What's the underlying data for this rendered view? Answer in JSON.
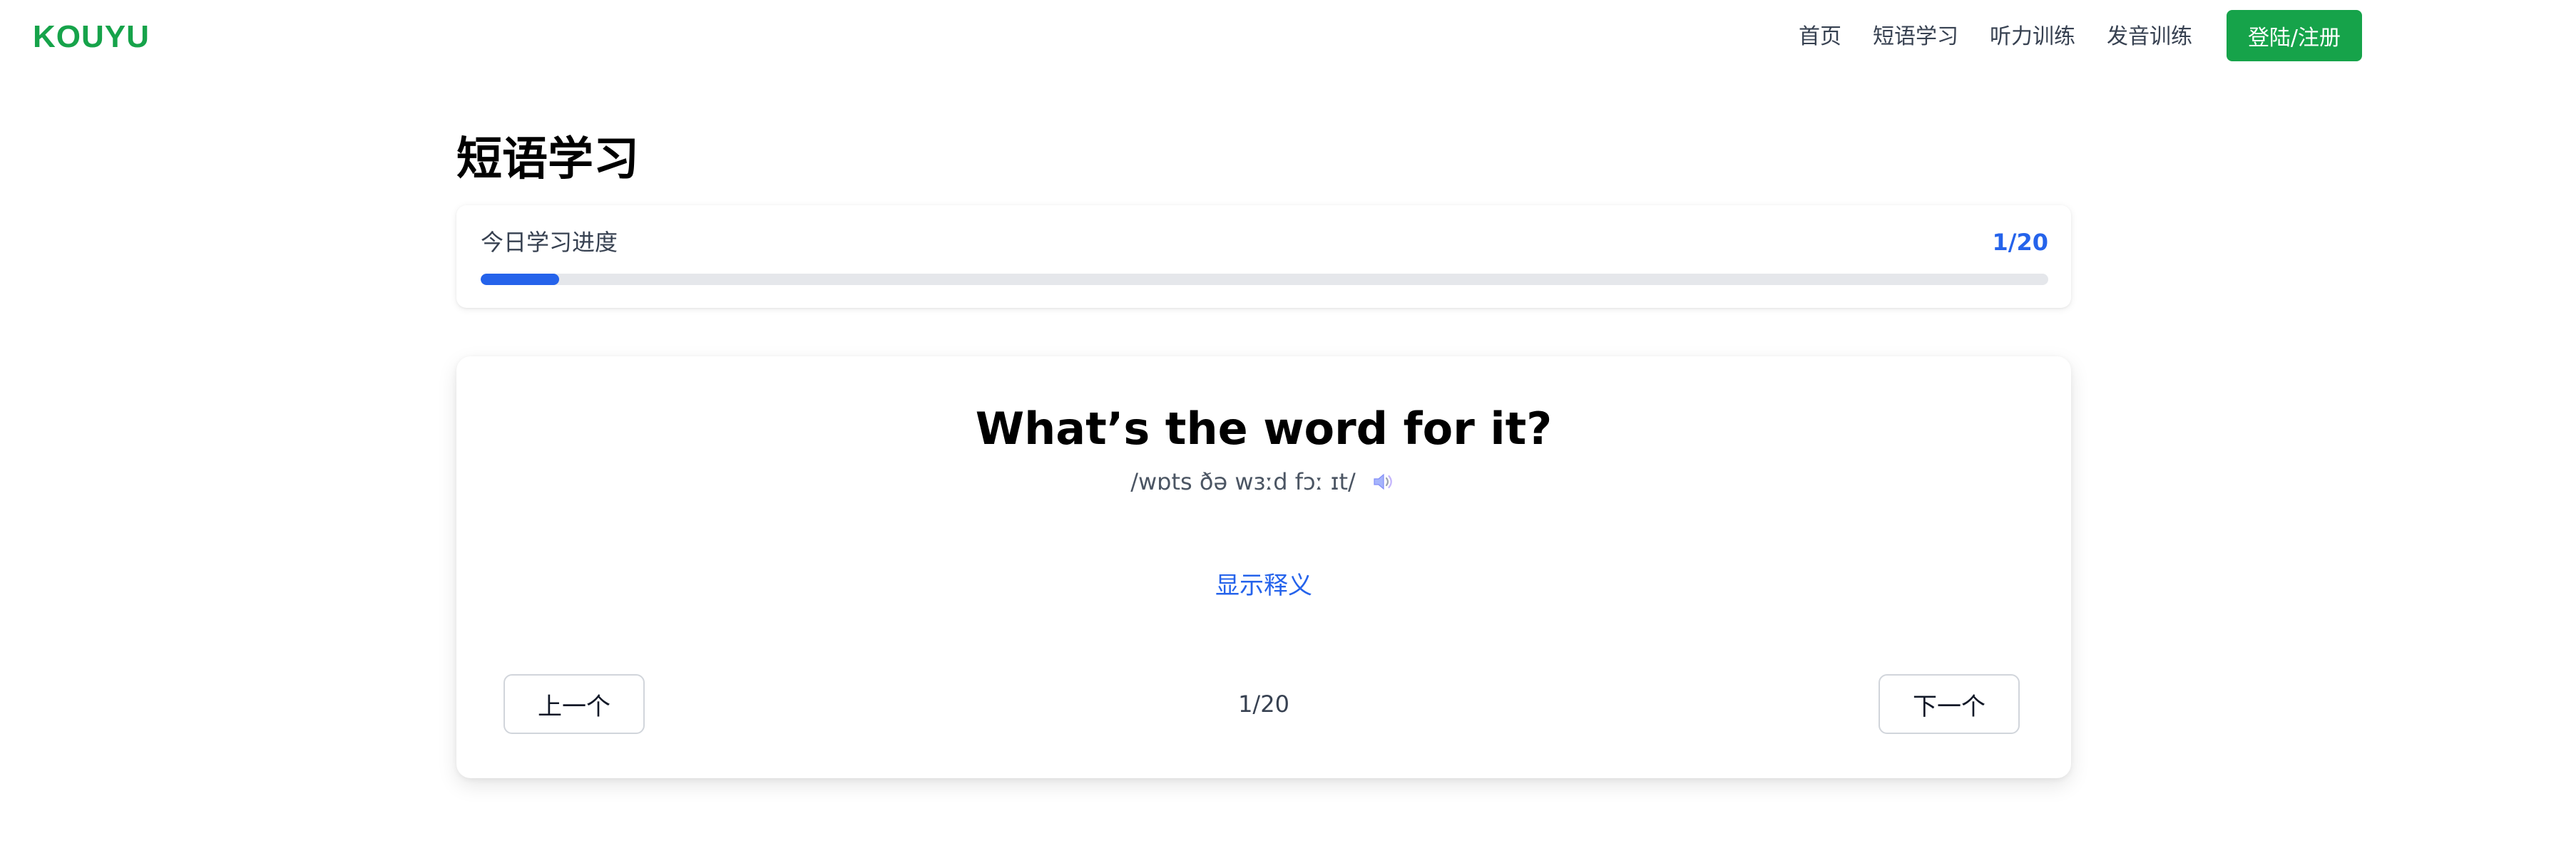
{
  "header": {
    "logo": "KOUYU",
    "nav": [
      {
        "label": "首页"
      },
      {
        "label": "短语学习"
      },
      {
        "label": "听力训练"
      },
      {
        "label": "发音训练"
      }
    ],
    "login_label": "登陆/注册"
  },
  "page": {
    "title": "短语学习"
  },
  "progress": {
    "label": "今日学习进度",
    "count_text": "1/20",
    "current": 1,
    "total": 20,
    "fraction": 0.05
  },
  "card": {
    "phrase": "What’s the word for it?",
    "phonetic": "/wɒts ðə wɜːd fɔː ɪt/",
    "speaker_icon": "speaker-icon",
    "show_meaning": "显示释义",
    "prev_label": "上一个",
    "next_label": "下一个",
    "page_indicator": "1/20"
  },
  "colors": {
    "brand": "#16a34a",
    "accent": "#2563eb"
  }
}
